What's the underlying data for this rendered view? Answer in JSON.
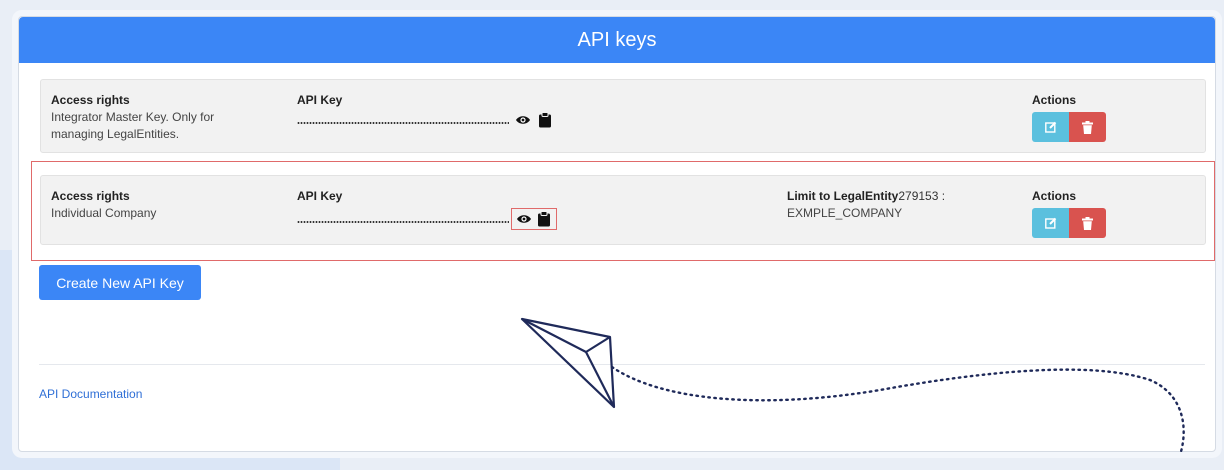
{
  "panel": {
    "title": "API keys"
  },
  "rows": [
    {
      "access_label": "Access rights",
      "access_value": "Integrator Master Key. Only for managing LegalEntities.",
      "key_label": "API Key",
      "actions_label": "Actions"
    },
    {
      "access_label": "Access rights",
      "access_value": "Individual Company",
      "key_label": "API Key",
      "limit_label": "Limit to LegalEntity",
      "limit_entity_id": "279153 :",
      "limit_value": "EXMPLE_COMPANY",
      "actions_label": "Actions"
    }
  ],
  "create_button": "Create New API Key",
  "doc_link": "API Documentation",
  "icons": {
    "show_key": "eye-icon",
    "copy_key": "clipboard-icon",
    "edit": "edit-icon",
    "delete": "trash-icon"
  },
  "colors": {
    "primary": "#3b86f6",
    "edit": "#5bc0de",
    "delete": "#d9534f",
    "highlight": "#e06a6a",
    "annotation": "#1f2a5a"
  }
}
